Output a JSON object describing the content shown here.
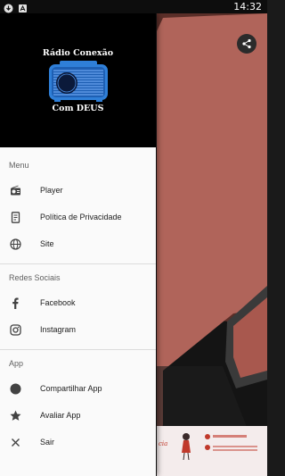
{
  "status_bar": {
    "time": "14:32",
    "left_icons": [
      "download-notification-icon",
      "app-notification-icon"
    ]
  },
  "drawer": {
    "header": {
      "logo_line1": "Rádio Conexão",
      "logo_line2": "Com DEUS"
    },
    "sections": [
      {
        "title": "Menu",
        "items": [
          {
            "label": "Player",
            "icon": "radio-icon"
          },
          {
            "label": "Política de Privacidade",
            "icon": "document-icon"
          },
          {
            "label": "Site",
            "icon": "globe-icon"
          }
        ]
      },
      {
        "title": "Redes Sociais",
        "items": [
          {
            "label": "Facebook",
            "icon": "facebook-icon"
          },
          {
            "label": "Instagram",
            "icon": "instagram-icon"
          }
        ]
      },
      {
        "title": "App",
        "items": [
          {
            "label": "Compartilhar App",
            "icon": "share-circle-icon"
          },
          {
            "label": "Avaliar App",
            "icon": "star-icon"
          },
          {
            "label": "Sair",
            "icon": "close-icon"
          }
        ]
      }
    ]
  },
  "background": {
    "share_icon": "share-icon"
  },
  "colors": {
    "drawer_bg": "#fafafa",
    "header_bg": "#000000",
    "section_title": "#616161",
    "item_text": "#212121",
    "icon": "#424242",
    "radio_blue": "#2f7fd8",
    "background_panel": "#b0645a"
  }
}
